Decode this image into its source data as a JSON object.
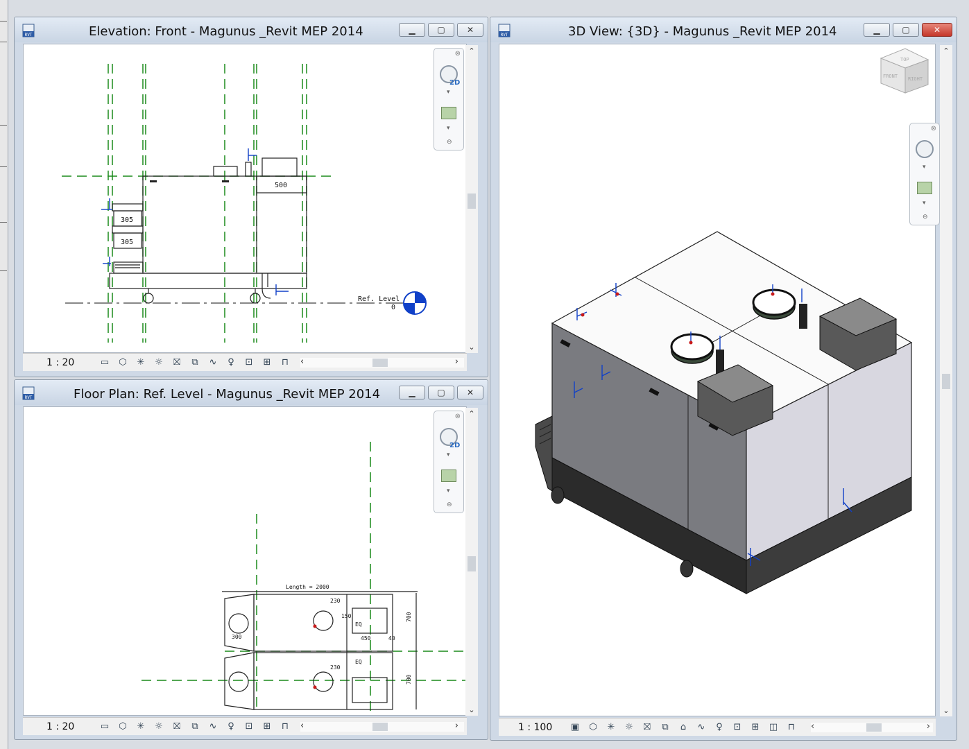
{
  "windows": {
    "elevation": {
      "title": "Elevation: Front - Magunus _Revit MEP 2014",
      "scale": "1 : 20",
      "annotations": {
        "dim1": "305",
        "dim2": "305",
        "dim3": "500",
        "level_name": "Ref. Level",
        "level_value": "0"
      }
    },
    "floorplan": {
      "title": "Floor Plan: Ref. Level - Magunus _Revit MEP 2014",
      "scale": "1 : 20",
      "annotations": {
        "length": "Length = 2000",
        "d230a": "230",
        "d230b": "230",
        "d700a": "700",
        "d700b": "700",
        "eq": "EQ",
        "d300": "300",
        "d450": "450",
        "d40": "40",
        "d150": "150"
      }
    },
    "view3d": {
      "title": "3D View: {3D} - Magunus _Revit MEP 2014",
      "scale": "1 : 100",
      "viewcube": {
        "top": "TOP",
        "front": "FRONT",
        "right": "RIGHT"
      }
    }
  },
  "nav": {
    "label_2d": "2D"
  },
  "colors": {
    "grid_green": "#1a8a1a",
    "accent_blue": "#1040c8",
    "close_red": "#c4372a"
  }
}
